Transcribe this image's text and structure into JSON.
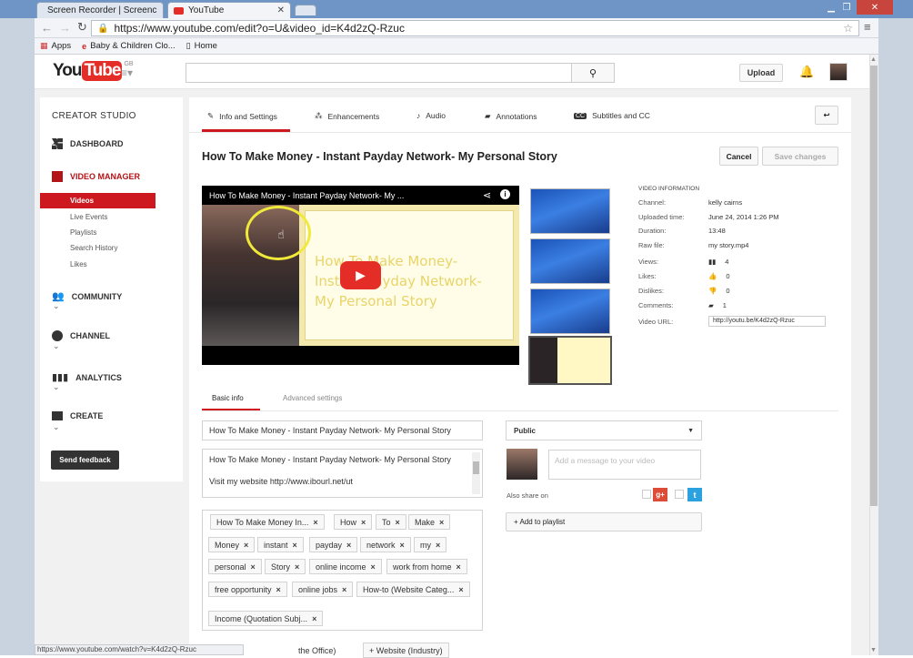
{
  "browser": {
    "tabs": [
      {
        "label": "Screen Recorder | Screenc",
        "icon": "screen-recorder-icon"
      },
      {
        "label": "YouTube",
        "icon": "youtube-icon"
      }
    ],
    "url": "https://www.youtube.com/edit?o=U&video_id=K4d2zQ-Rzuc",
    "bookmarks": [
      "Apps",
      "Baby & Children Clo...",
      "Home"
    ],
    "status_url": "https://www.youtube.com/watch?v=K4d2zQ-Rzuc"
  },
  "header": {
    "logo": "You",
    "logo_tube": "Tube",
    "region": "GB",
    "upload_label": "Upload"
  },
  "sidebar": {
    "title": "CREATOR STUDIO",
    "dashboard": "DASHBOARD",
    "video_manager": "VIDEO MANAGER",
    "sub_items": [
      "Videos",
      "Live Events",
      "Playlists",
      "Search History",
      "Likes"
    ],
    "community": "COMMUNITY",
    "channel": "CHANNEL",
    "analytics": "ANALYTICS",
    "create": "CREATE",
    "feedback": "Send feedback"
  },
  "tabs": [
    "Info and Settings",
    "Enhancements",
    "Audio",
    "Annotations",
    "Subtitles and CC"
  ],
  "video": {
    "title": "How To Make Money - Instant Payday Network- My Personal Story",
    "player_title": "How To Make Money - Instant Payday Network- My ...",
    "overlay_text": "How To Make Money-\nInstant Payday Network-\nMy Personal Story",
    "cancel_label": "Cancel",
    "save_label": "Save changes"
  },
  "info": {
    "heading": "VIDEO INFORMATION",
    "channel_label": "Channel:",
    "channel": "kelly cairns",
    "uploaded_label": "Uploaded time:",
    "uploaded": "June 24, 2014 1:26 PM",
    "duration_label": "Duration:",
    "duration": "13:48",
    "raw_label": "Raw file:",
    "raw": "my story.mp4",
    "views_label": "Views:",
    "views": "4",
    "likes_label": "Likes:",
    "likes": "0",
    "dislikes_label": "Dislikes:",
    "dislikes": "0",
    "comments_label": "Comments:",
    "comments": "1",
    "url_label": "Video URL:",
    "url": "http://youtu.be/K4d2zQ-Rzuc"
  },
  "subtabs": [
    "Basic info",
    "Advanced settings"
  ],
  "form": {
    "title_value": "How To Make Money - Instant Payday Network- My Personal Story",
    "description": "How To Make Money - Instant Payday Network- My Personal Story\n\nVisit my website http://www.ibourl.net/ut",
    "privacy": "Public",
    "message_placeholder": "Add a message to your video",
    "share_label": "Also share on",
    "playlist_label": "+ Add to playlist",
    "tags": [
      "How To Make Money In...",
      "How",
      "To",
      "Make",
      "Money",
      "instant",
      "payday",
      "network",
      "my",
      "personal",
      "Story",
      "online income",
      "work from home",
      "free opportunity",
      "online jobs",
      "How-to (Website Categ...",
      "Income (Quotation Subj..."
    ],
    "suggestions": [
      "the Office)",
      "+ Website (Industry)"
    ]
  }
}
